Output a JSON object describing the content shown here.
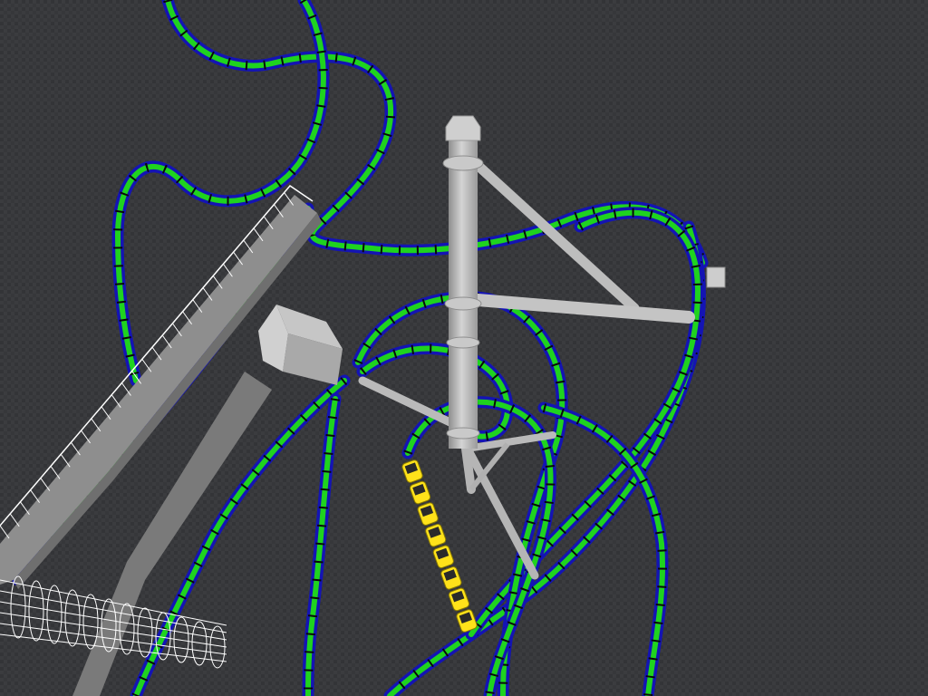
{
  "scene": {
    "kind": "roller-coaster-simulator-3d-view",
    "camera": "aerial-oblique",
    "ground": {
      "color": "#3c3d40",
      "tile_color": "#2e2f32"
    },
    "track": {
      "rail_color": "#1414b4",
      "spine_color": "#1fd31f",
      "tie_color": "#0a0a0a",
      "segments": [
        "upper-left-loop",
        "left-curve",
        "station-run",
        "center-overbank",
        "right-helix",
        "lower-left-drop",
        "lower-center-drop",
        "lower-right-drop",
        "inner-loop"
      ]
    },
    "support_tower": {
      "color": "#bdbdbd",
      "shade_color": "#8c8c8c",
      "arms": 4
    },
    "station": {
      "platform_color": "#8a8a8a",
      "railing_color": "#ffffff",
      "building_color": "#b8b8b8"
    },
    "tunnel": {
      "style": "wireframe",
      "color": "#ffffff"
    },
    "train": {
      "car_count": 8,
      "car_color": "#ffe21a",
      "seat_color": "#2a2a2a"
    }
  }
}
